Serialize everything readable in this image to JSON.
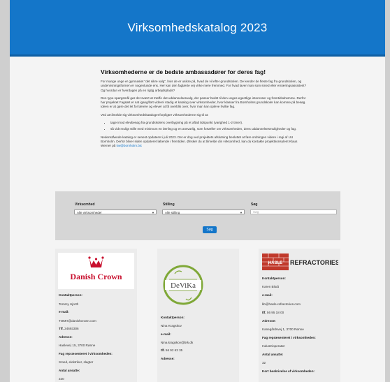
{
  "banner": {
    "title": "Virksomhedskatalog 2023"
  },
  "intro": {
    "heading": "Virksomhederne er de bedste ambassadører for deres fag!",
    "p1": "For mange unge er gymnasiet \"det sikre valg\", hvis de er usikre på, hvad de vil efter grundskolen. De kender de fleste fag fra grundskolen, og undervisningsformen er nogenlunde ens. Her kan den faglærte vej virke mere fremmed. For hvad laver man som smed eller ernæringsassistent? Og hvordan er hverdagen på en rigtig arbejdsplads?",
    "p2": "Den type spørgsmål gør det svært at træffe det uddannelsesvalg, der passer bedst til den unges egentlige interesser og fremtidsdrømme. Derfor har projektet Fagsæt er sat igang/ført videre/ stadig et katalog over virksomheder, hvor klasser fra Bornholms grundskoler kan komme på besøg. Ideen er at gøre det let for lærere og elever at få overblik over, hvor man kan opleve hvilke fag.",
    "p3": "Ved at tilmelde sig virksomhedskataloget forpligter virksomhederne sig til at:",
    "bullets": [
      "tage imod elevbesøg fra grundskolens overbygning på et aftalt tidspunkt (varighed 1-2 timer).",
      "så vidt muligt stille med minimum en lærling og en ansvarlig, som fortæller om virksomheden, dens uddannelsesmuligheder og fag."
    ],
    "p4_prefix": "Nedenstående katalog er senest opdateret i juli 2023. Det er dog ved projektets afslutning besluttet at føre ordningen videre i regi af UU Bornholm. Derfor bliver siden opdateret løbende i fremtiden. Ønsker du at tilmelde din virksomhed, kan du kontakte projektkonsulent Klaus Werner på",
    "p4_link": "kw@bornholm.bic"
  },
  "filter": {
    "label_company": "Virksomhed",
    "select_company": "Alle virksomheder",
    "label_position": "Stilling",
    "select_position": "Alle stilling",
    "label_search": "Søg",
    "search_placeholder": "Søg",
    "search_button": "Søg"
  },
  "cards": [
    {
      "logo": "Danish Crown",
      "contact_label": "Kontaktperson:",
      "contact": "Tommy Hjorth",
      "email_label": "e-mail:",
      "email": "TOMH@danishcrown.com",
      "phone_label": "Tlf.",
      "phone": "24693306",
      "address_label": "Adresse:",
      "address": "Hasleve) 15, 3700 Rønne",
      "trades_label": "Fag repræsenteret i virksomheden:",
      "trades": "Smed, elektriker, slagter",
      "staff_label": "Antal ansatte:",
      "staff": "220"
    },
    {
      "logo": "DeViKa",
      "contact_label": "Kontaktperson:",
      "contact": "Nina Kragskov",
      "email_label": "e-mail:",
      "email": "Nina.kragskov@brk.dk",
      "phone_label": "tlf.",
      "phone": "56 92 63 35",
      "address_label": "Adresse:"
    },
    {
      "logo_left": "HASLE",
      "logo_right": "REFRACTORIES",
      "contact_label": "Kontaktperson:",
      "contact": "Karen Blodt",
      "email_label": "e-mail:",
      "email": "kb@hasle-refractories.com",
      "phone_label": "tlf.",
      "phone": "56 95 18 00",
      "address_label": "Adresse:",
      "address": "Kanegårdsvej 1, 3700 Rønne",
      "trades_label": "Fag repræsenteret i virksomheden:",
      "trades": "Industrioperatør",
      "staff_label": "Antal ansatte:",
      "staff": "32",
      "description_label": "Kort beskrivelse af virksomheden:"
    }
  ],
  "colors": {
    "accent": "#1476c9",
    "danish_crown_red": "#c8102e",
    "devika_green": "#7fa838",
    "hasle_red": "#c0392b"
  }
}
